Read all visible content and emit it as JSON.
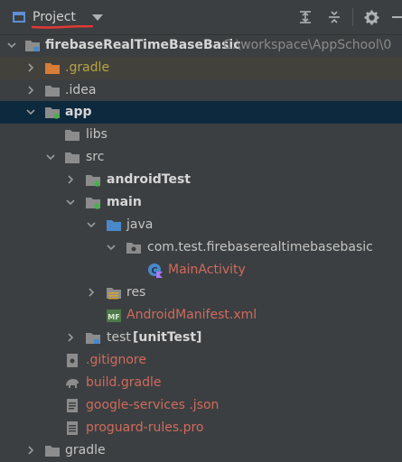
{
  "toolbar": {
    "title": "Project",
    "icons": [
      "expand-all-icon",
      "collapse-all-icon",
      "gear-icon",
      "minimize-icon"
    ]
  },
  "tree": {
    "root": {
      "name": "firebaseRealTimeBaseBasic",
      "path": "C:\\workspace\\AppSchool\\0"
    },
    "gradle_dir": ".gradle",
    "idea_dir": ".idea",
    "app": "app",
    "libs": "libs",
    "src": "src",
    "android_test": "androidTest",
    "main": "main",
    "java": "java",
    "package": "com.test.firebaserealtimebasebasic",
    "main_activity": "MainActivity",
    "res": "res",
    "manifest": "AndroidManifest.xml",
    "test": "test",
    "test_suffix": "[unitTest]",
    "gitignore": ".gitignore",
    "build_gradle": "build.gradle",
    "google_services": "google-services .json",
    "proguard": "proguard-rules.pro",
    "gradle_partial": "gradle"
  },
  "colors": {
    "background": "#3c3f41",
    "selected_row": "#0d293e",
    "highlight_row": "#43413c",
    "folder": "#8c8c8c",
    "module_dot": "#4caf50",
    "accent_red": "#e53935"
  }
}
